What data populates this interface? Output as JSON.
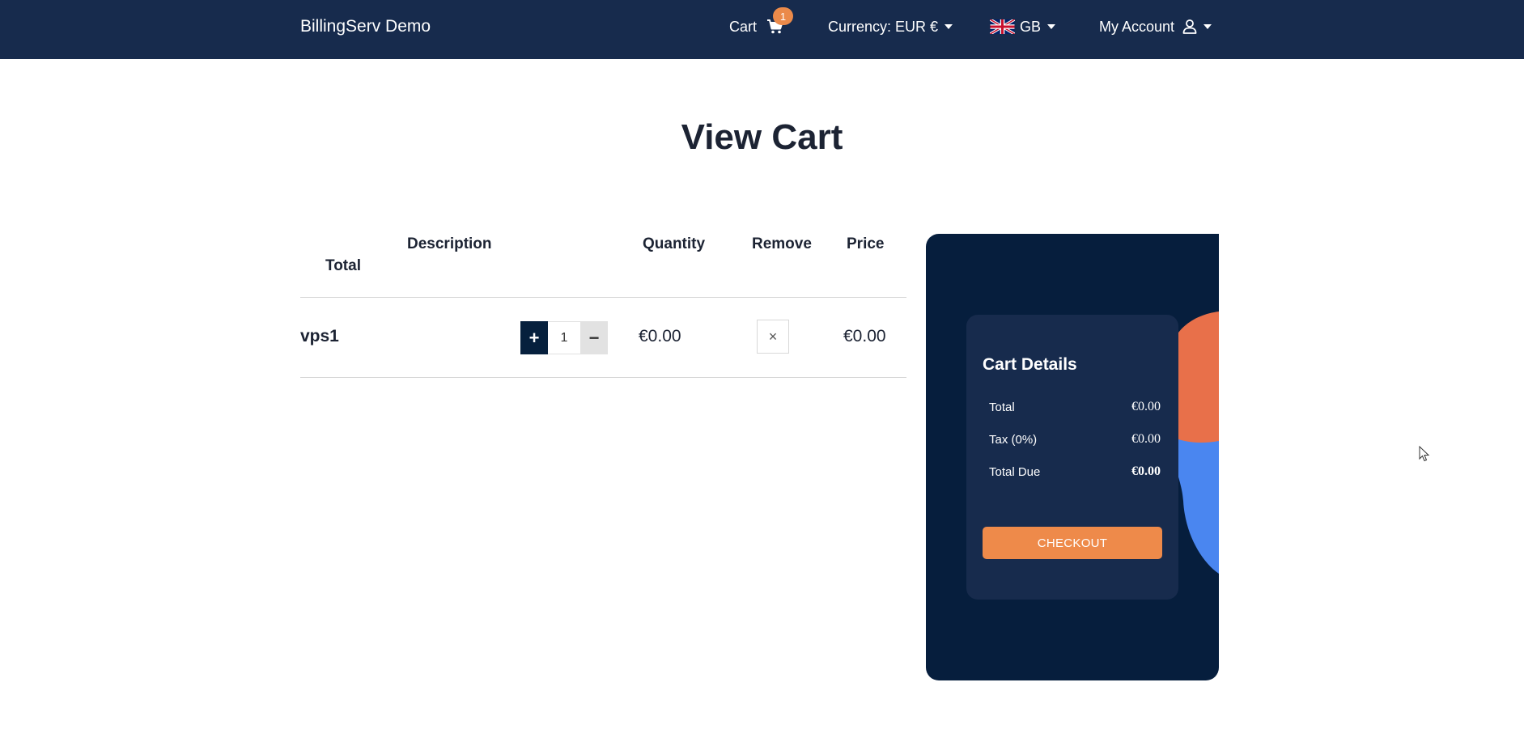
{
  "navbar": {
    "brand": "BillingServ Demo",
    "cart_label": "Cart",
    "cart_count": "1",
    "currency_label": "Currency: EUR €",
    "language_label": "GB",
    "account_label": "My Account"
  },
  "page": {
    "title": "View Cart"
  },
  "table": {
    "headers": {
      "description": "Description",
      "quantity": "Quantity",
      "remove": "Remove",
      "price": "Price",
      "total": "Total"
    },
    "rows": [
      {
        "name": "vps1",
        "quantity": "1",
        "unit_price": "€0.00",
        "remove_symbol": "×",
        "price": "€0.00"
      }
    ],
    "plus_symbol": "+",
    "minus_symbol": "−"
  },
  "cart_details": {
    "title": "Cart Details",
    "total_label": "Total",
    "total_value": "€0.00",
    "tax_label": "Tax (0%)",
    "tax_value": "€0.00",
    "due_label": "Total Due",
    "due_value": "€0.00",
    "checkout_label": "CHECKOUT"
  },
  "colors": {
    "navbar": "#172b4d",
    "panel": "#061e3d",
    "card": "#172b4d",
    "accent_orange": "#ee8a4a",
    "deco_orange": "#e8704a",
    "deco_blue": "#4a86f0"
  },
  "icons": [
    "cart-icon",
    "caret-down-icon",
    "uk-flag-icon",
    "user-icon",
    "close-icon",
    "mouse-cursor"
  ]
}
